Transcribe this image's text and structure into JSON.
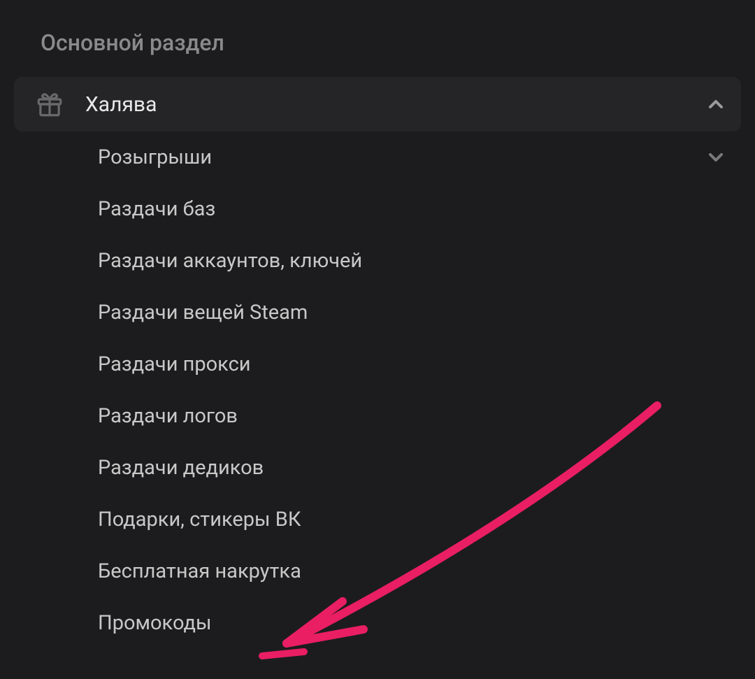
{
  "section": {
    "title": "Основной раздел"
  },
  "menu": {
    "main": {
      "label": "Халява",
      "icon": "gift-icon"
    },
    "subitems": [
      {
        "label": "Розыгрыши",
        "expandable": true
      },
      {
        "label": "Раздачи баз",
        "expandable": false
      },
      {
        "label": "Раздачи аккаунтов, ключей",
        "expandable": false
      },
      {
        "label": "Раздачи вещей Steam",
        "expandable": false
      },
      {
        "label": "Раздачи прокси",
        "expandable": false
      },
      {
        "label": "Раздачи логов",
        "expandable": false
      },
      {
        "label": "Раздачи дедиков",
        "expandable": false
      },
      {
        "label": "Подарки, стикеры ВК",
        "expandable": false
      },
      {
        "label": "Бесплатная накрутка",
        "expandable": false
      },
      {
        "label": "Промокоды",
        "expandable": false
      }
    ]
  },
  "annotation": {
    "color": "#e91e63"
  }
}
